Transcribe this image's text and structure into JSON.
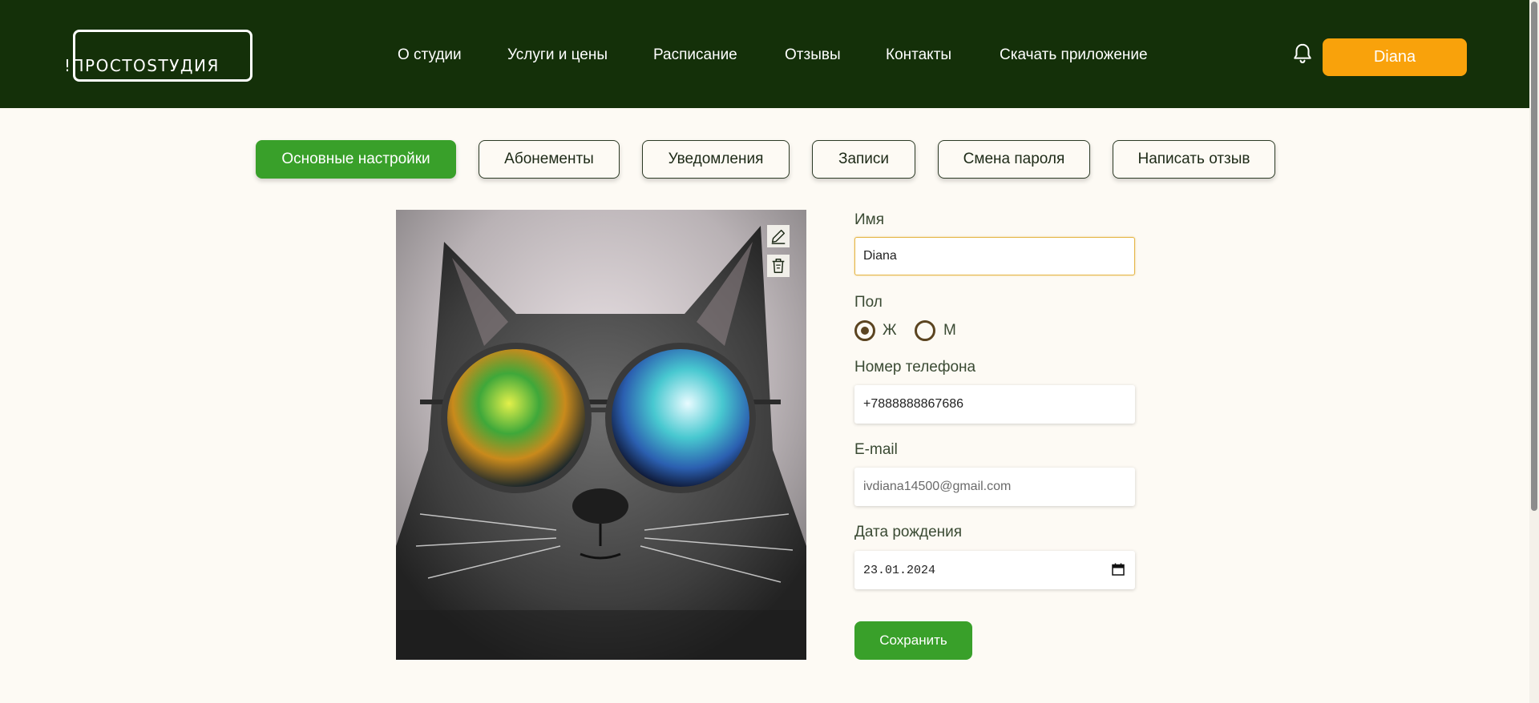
{
  "header": {
    "logo_text": "!ПРОСТОSТУДИЯ",
    "nav": [
      "О студии",
      "Услуги и цены",
      "Расписание",
      "Отзывы",
      "Контакты",
      "Скачать приложение"
    ],
    "user_button": "Diana",
    "bell_icon": "bell-icon"
  },
  "tabs": [
    {
      "label": "Основные настройки",
      "active": true
    },
    {
      "label": "Абонементы",
      "active": false
    },
    {
      "label": "Уведомления",
      "active": false
    },
    {
      "label": "Записи",
      "active": false
    },
    {
      "label": "Смена пароля",
      "active": false
    },
    {
      "label": "Написать отзыв",
      "active": false
    }
  ],
  "photo": {
    "edit_icon": "pencil-icon",
    "delete_icon": "trash-icon"
  },
  "form": {
    "name_label": "Имя",
    "name_value": "Diana",
    "gender_label": "Пол",
    "gender_female": "Ж",
    "gender_male": "М",
    "gender_selected": "Ж",
    "phone_label": "Номер телефона",
    "phone_value": "+7888888867686",
    "email_label": "E-mail",
    "email_placeholder": "ivdiana14500@gmail.com",
    "birth_label": "Дата рождения",
    "birth_value": "23.01.2024",
    "save_label": "Сохранить"
  },
  "colors": {
    "header_bg": "#143009",
    "accent_green": "#39a02a",
    "user_button": "#f9a20b",
    "page_bg": "#fdfaf4"
  }
}
